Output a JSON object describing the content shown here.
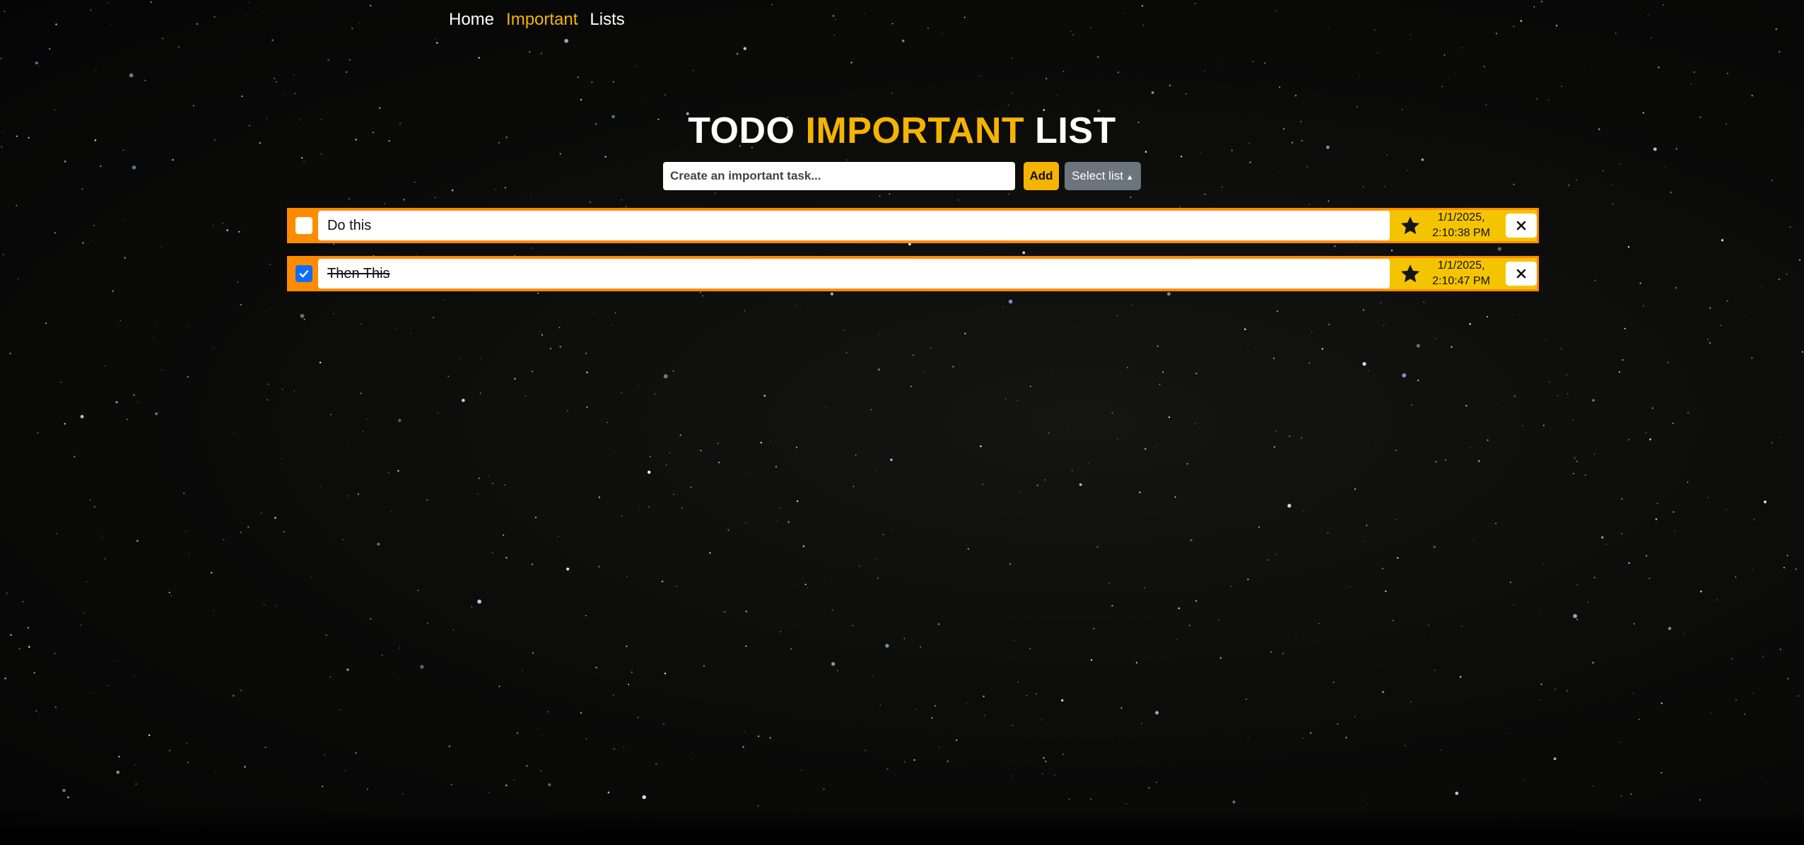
{
  "nav": {
    "items": [
      {
        "label": "Home",
        "active": false
      },
      {
        "label": "Important",
        "active": true
      },
      {
        "label": "Lists",
        "active": false
      }
    ]
  },
  "header": {
    "title_prefix": "TODO ",
    "title_accent": "IMPORTANT",
    "title_suffix": " LIST"
  },
  "form": {
    "placeholder": "Create an important task...",
    "value": "",
    "add_label": "Add",
    "select_label": "Select list"
  },
  "tasks": [
    {
      "text": "Do this",
      "done": false,
      "starred": true,
      "date_line1": "1/1/2025,",
      "date_line2": "2:10:38 PM"
    },
    {
      "text": "Then This",
      "done": true,
      "starred": true,
      "date_line1": "1/1/2025,",
      "date_line2": "2:10:47 PM"
    }
  ],
  "icons": {
    "checkbox": "checkbox-icon",
    "star": "star-icon",
    "close": "close-icon",
    "caret": "caret-up-icon"
  },
  "colors": {
    "accent": "#f5b400",
    "task_border": "#ff8a00",
    "task_right": "#f5c400",
    "check_checked": "#0d6efd",
    "select_button": "#6c757d"
  }
}
